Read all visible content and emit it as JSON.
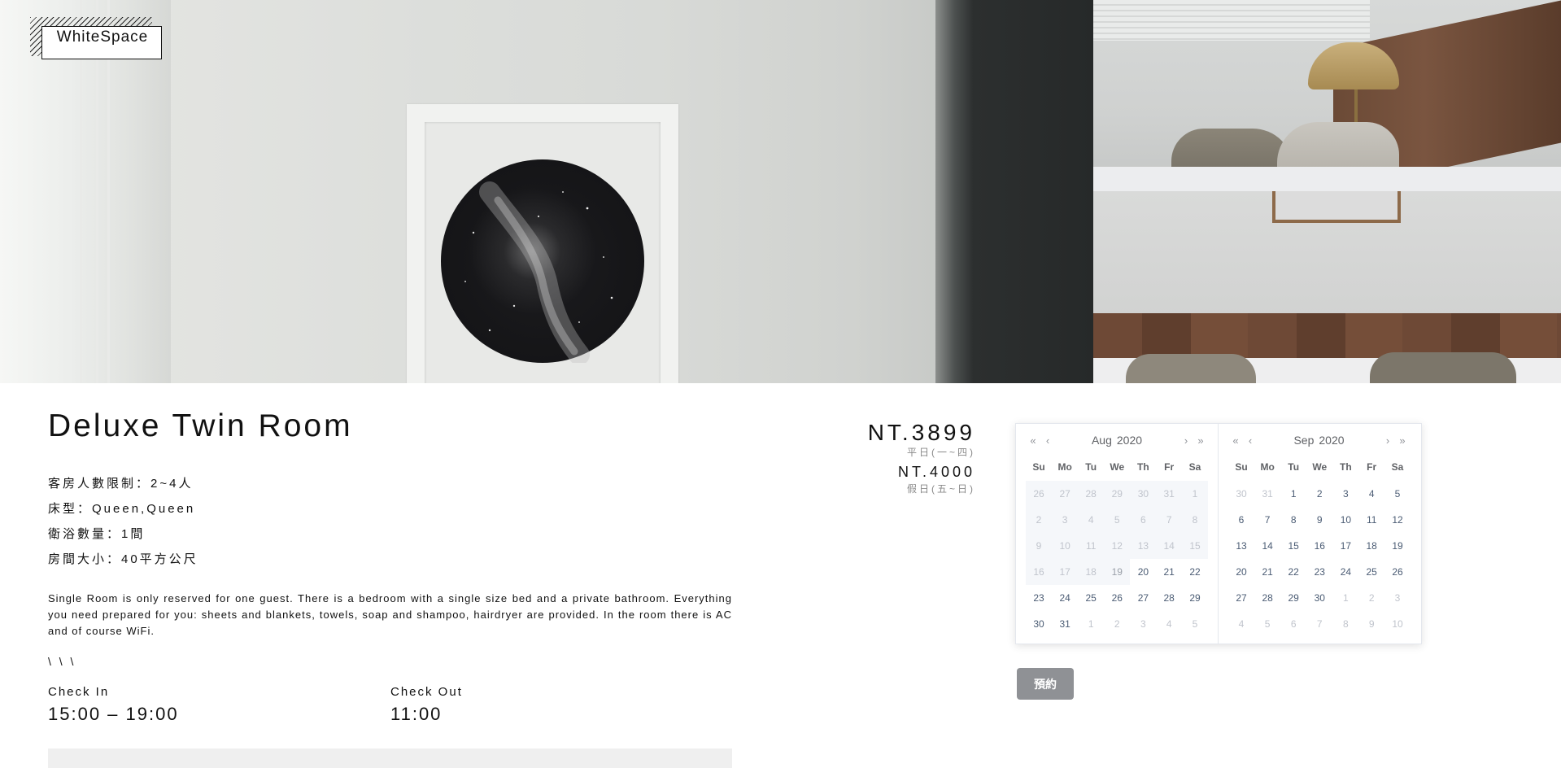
{
  "brand": {
    "logo_text": "WhiteSpace"
  },
  "room": {
    "title": "Deluxe Twin Room",
    "info": [
      "客房人數限制：2~4人",
      "床型：Queen,Queen",
      "衛浴數量：1間",
      "房間大小：40平方公尺"
    ],
    "description": "Single Room is only reserved for one guest. There is a bedroom with a single size bed and a private bathroom. Everything you need prepared for you: sheets and blankets, towels, soap and shampoo, hairdryer are provided. In the room there is AC and of course WiFi.",
    "slashes": "\\ \\ \\",
    "check_in": {
      "label": "Check In",
      "time": "15:00 – 19:00"
    },
    "check_out": {
      "label": "Check Out",
      "time": "11:00"
    }
  },
  "pricing": {
    "weekday_price": "NT.3899",
    "weekday_note": "平日(一~四)",
    "weekend_price": "NT.4000",
    "weekend_note": "假日(五~日)"
  },
  "calendar": {
    "weekdays": [
      "Su",
      "Mo",
      "Tu",
      "We",
      "Th",
      "Fr",
      "Sa"
    ],
    "nav": {
      "prev_year": "«",
      "prev_month": "‹",
      "next_month": "›",
      "next_year": "»"
    },
    "months": [
      {
        "month": "Aug",
        "year": "2020",
        "weeks": [
          [
            {
              "d": "26",
              "s": "disabled"
            },
            {
              "d": "27",
              "s": "disabled"
            },
            {
              "d": "28",
              "s": "disabled"
            },
            {
              "d": "29",
              "s": "disabled"
            },
            {
              "d": "30",
              "s": "disabled"
            },
            {
              "d": "31",
              "s": "disabled"
            },
            {
              "d": "1",
              "s": "disabled"
            }
          ],
          [
            {
              "d": "2",
              "s": "disabled"
            },
            {
              "d": "3",
              "s": "disabled"
            },
            {
              "d": "4",
              "s": "disabled"
            },
            {
              "d": "5",
              "s": "disabled"
            },
            {
              "d": "6",
              "s": "disabled"
            },
            {
              "d": "7",
              "s": "disabled"
            },
            {
              "d": "8",
              "s": "disabled"
            }
          ],
          [
            {
              "d": "9",
              "s": "disabled"
            },
            {
              "d": "10",
              "s": "disabled"
            },
            {
              "d": "11",
              "s": "disabled"
            },
            {
              "d": "12",
              "s": "disabled"
            },
            {
              "d": "13",
              "s": "disabled"
            },
            {
              "d": "14",
              "s": "disabled"
            },
            {
              "d": "15",
              "s": "disabled"
            }
          ],
          [
            {
              "d": "16",
              "s": "disabled"
            },
            {
              "d": "17",
              "s": "disabled"
            },
            {
              "d": "18",
              "s": "disabled"
            },
            {
              "d": "19",
              "s": "disabled-cur"
            },
            {
              "d": "20",
              "s": "available"
            },
            {
              "d": "21",
              "s": "available"
            },
            {
              "d": "22",
              "s": "available"
            }
          ],
          [
            {
              "d": "23",
              "s": "available"
            },
            {
              "d": "24",
              "s": "available"
            },
            {
              "d": "25",
              "s": "available"
            },
            {
              "d": "26",
              "s": "available"
            },
            {
              "d": "27",
              "s": "available"
            },
            {
              "d": "28",
              "s": "available"
            },
            {
              "d": "29",
              "s": "available"
            }
          ],
          [
            {
              "d": "30",
              "s": "available"
            },
            {
              "d": "31",
              "s": "available"
            },
            {
              "d": "1",
              "s": "muted"
            },
            {
              "d": "2",
              "s": "muted"
            },
            {
              "d": "3",
              "s": "muted"
            },
            {
              "d": "4",
              "s": "muted"
            },
            {
              "d": "5",
              "s": "muted"
            }
          ]
        ]
      },
      {
        "month": "Sep",
        "year": "2020",
        "weeks": [
          [
            {
              "d": "30",
              "s": "muted"
            },
            {
              "d": "31",
              "s": "muted"
            },
            {
              "d": "1",
              "s": "available"
            },
            {
              "d": "2",
              "s": "available"
            },
            {
              "d": "3",
              "s": "available"
            },
            {
              "d": "4",
              "s": "available"
            },
            {
              "d": "5",
              "s": "available"
            }
          ],
          [
            {
              "d": "6",
              "s": "available"
            },
            {
              "d": "7",
              "s": "available"
            },
            {
              "d": "8",
              "s": "available"
            },
            {
              "d": "9",
              "s": "available"
            },
            {
              "d": "10",
              "s": "available"
            },
            {
              "d": "11",
              "s": "available"
            },
            {
              "d": "12",
              "s": "available"
            }
          ],
          [
            {
              "d": "13",
              "s": "available"
            },
            {
              "d": "14",
              "s": "available"
            },
            {
              "d": "15",
              "s": "available"
            },
            {
              "d": "16",
              "s": "available"
            },
            {
              "d": "17",
              "s": "available"
            },
            {
              "d": "18",
              "s": "available"
            },
            {
              "d": "19",
              "s": "available"
            }
          ],
          [
            {
              "d": "20",
              "s": "available"
            },
            {
              "d": "21",
              "s": "available"
            },
            {
              "d": "22",
              "s": "available"
            },
            {
              "d": "23",
              "s": "available"
            },
            {
              "d": "24",
              "s": "available"
            },
            {
              "d": "25",
              "s": "available"
            },
            {
              "d": "26",
              "s": "available"
            }
          ],
          [
            {
              "d": "27",
              "s": "available"
            },
            {
              "d": "28",
              "s": "available"
            },
            {
              "d": "29",
              "s": "available"
            },
            {
              "d": "30",
              "s": "available"
            },
            {
              "d": "1",
              "s": "muted"
            },
            {
              "d": "2",
              "s": "muted"
            },
            {
              "d": "3",
              "s": "muted"
            }
          ],
          [
            {
              "d": "4",
              "s": "muted"
            },
            {
              "d": "5",
              "s": "muted"
            },
            {
              "d": "6",
              "s": "muted"
            },
            {
              "d": "7",
              "s": "muted"
            },
            {
              "d": "8",
              "s": "muted"
            },
            {
              "d": "9",
              "s": "muted"
            },
            {
              "d": "10",
              "s": "muted"
            }
          ]
        ]
      }
    ]
  },
  "booking": {
    "button_label": "預約"
  },
  "colors": {
    "button_bg": "#8f9195",
    "calendar_text": "#4a5b73",
    "calendar_muted": "#c0c4cc",
    "calendar_disabled_bg": "#f5f7fa"
  }
}
